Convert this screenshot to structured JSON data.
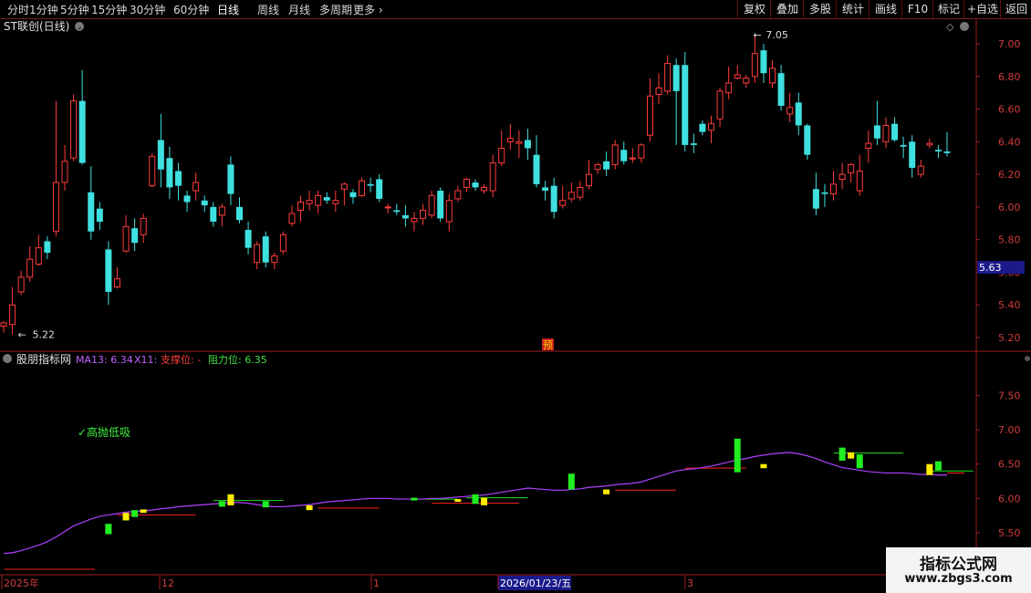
{
  "toolbar": {
    "periods": [
      "分时",
      "1分钟",
      "5分钟",
      "15分钟",
      "30分钟",
      "60分钟",
      "日线",
      "周线",
      "月线",
      "多周期",
      "更多"
    ],
    "active_period": "日线",
    "right_buttons": [
      "复权",
      "叠加",
      "多股",
      "统计",
      "画线",
      "F10",
      "标记",
      "+自选",
      "返回"
    ]
  },
  "stock": {
    "title": "ST联创(日线)"
  },
  "price_panel": {
    "axis_labels": [
      "7.00",
      "6.80",
      "6.60",
      "6.40",
      "6.20",
      "6.00",
      "5.80",
      "5.60",
      "5.40",
      "5.20"
    ],
    "ylim": [
      5.15,
      7.2
    ],
    "high_label": "7.05",
    "low_label": "5.22",
    "current_price_label": "5.63",
    "current_price": 5.63,
    "badge": "预"
  },
  "indicator_panel": {
    "name": "股朋指标网",
    "ma_label": "MA13: 6.34",
    "x11_label": "X11:",
    "support_label": "支撑位: -",
    "resist_label": "阻力位: 6.35",
    "signal_text": "✓高抛低吸",
    "axis_labels": [
      "7.50",
      "7.00",
      "6.50",
      "6.00",
      "5.50"
    ],
    "ylim": [
      5.22,
      8.0
    ]
  },
  "time_axis": {
    "labels": [
      "2025年",
      "12",
      "1",
      "2026/01/23/五",
      "3"
    ]
  },
  "colors": {
    "up": "#ff3c3c",
    "down": "#3fe0e0",
    "ma": "#b040ff",
    "support": "#ff2020",
    "resist": "#20e020",
    "signal_up": "#20ee20",
    "signal_down": "#ffee00",
    "current_bg": "#1a1a8a"
  },
  "chart_data": {
    "type": "candlestick",
    "candles": [
      [
        5.27,
        5.29,
        5.3,
        5.23
      ],
      [
        5.28,
        5.4,
        5.51,
        5.22
      ],
      [
        5.48,
        5.57,
        5.61,
        5.46
      ],
      [
        5.57,
        5.68,
        5.76,
        5.54
      ],
      [
        5.65,
        5.75,
        5.83,
        5.64
      ],
      [
        5.79,
        5.72,
        5.82,
        5.68
      ],
      [
        5.85,
        6.15,
        6.65,
        5.82
      ],
      [
        6.15,
        6.28,
        6.38,
        6.1
      ],
      [
        6.3,
        6.65,
        6.69,
        6.28
      ],
      [
        6.65,
        6.27,
        6.84,
        6.26
      ],
      [
        6.09,
        5.85,
        6.25,
        5.8
      ],
      [
        5.99,
        5.91,
        6.03,
        5.86
      ],
      [
        5.74,
        5.48,
        5.79,
        5.4
      ],
      [
        5.51,
        5.56,
        5.63,
        5.5
      ],
      [
        5.73,
        5.88,
        5.95,
        5.72
      ],
      [
        5.87,
        5.78,
        5.93,
        5.73
      ],
      [
        5.83,
        5.93,
        5.96,
        5.78
      ],
      [
        6.13,
        6.31,
        6.33,
        6.12
      ],
      [
        6.41,
        6.23,
        6.57,
        6.12
      ],
      [
        6.3,
        6.12,
        6.37,
        6.05
      ],
      [
        6.22,
        6.13,
        6.27,
        6.04
      ],
      [
        6.07,
        6.03,
        6.1,
        5.97
      ],
      [
        6.1,
        6.15,
        6.21,
        6.04
      ],
      [
        6.04,
        6.01,
        6.07,
        5.97
      ],
      [
        6.0,
        5.91,
        6.03,
        5.88
      ],
      [
        5.95,
        6.0,
        6.02,
        5.88
      ],
      [
        6.26,
        6.08,
        6.31,
        6.01
      ],
      [
        6.0,
        5.92,
        6.06,
        5.9
      ],
      [
        5.86,
        5.75,
        5.91,
        5.71
      ],
      [
        5.66,
        5.77,
        5.79,
        5.62
      ],
      [
        5.82,
        5.66,
        5.85,
        5.63
      ],
      [
        5.66,
        5.7,
        5.72,
        5.62
      ],
      [
        5.73,
        5.83,
        5.85,
        5.71
      ],
      [
        5.9,
        5.96,
        6.01,
        5.88
      ],
      [
        5.98,
        6.03,
        6.07,
        5.91
      ],
      [
        6.02,
        6.04,
        6.1,
        5.98
      ],
      [
        6.01,
        6.07,
        6.1,
        5.96
      ],
      [
        6.06,
        6.04,
        6.09,
        6.02
      ],
      [
        6.02,
        6.04,
        6.1,
        5.97
      ],
      [
        6.11,
        6.14,
        6.15,
        6.01
      ],
      [
        6.09,
        6.06,
        6.11,
        6.02
      ],
      [
        6.07,
        6.16,
        6.18,
        6.06
      ],
      [
        6.14,
        6.13,
        6.18,
        6.09
      ],
      [
        6.17,
        6.05,
        6.2,
        6.03
      ],
      [
        6.0,
        6.0,
        6.02,
        5.96
      ],
      [
        5.98,
        5.97,
        6.02,
        5.95
      ],
      [
        5.95,
        5.93,
        6.01,
        5.88
      ],
      [
        5.91,
        5.93,
        5.97,
        5.85
      ],
      [
        5.93,
        5.98,
        6.02,
        5.89
      ],
      [
        5.95,
        6.07,
        6.1,
        5.93
      ],
      [
        6.1,
        5.93,
        6.12,
        5.91
      ],
      [
        5.91,
        6.04,
        6.08,
        5.85
      ],
      [
        6.05,
        6.1,
        6.13,
        6.03
      ],
      [
        6.12,
        6.17,
        6.18,
        6.09
      ],
      [
        6.15,
        6.12,
        6.17,
        6.1
      ],
      [
        6.1,
        6.12,
        6.14,
        6.08
      ],
      [
        6.1,
        6.27,
        6.32,
        6.06
      ],
      [
        6.27,
        6.36,
        6.47,
        6.25
      ],
      [
        6.4,
        6.42,
        6.51,
        6.35
      ],
      [
        6.39,
        6.4,
        6.47,
        6.3
      ],
      [
        6.41,
        6.36,
        6.48,
        6.29
      ],
      [
        6.32,
        6.14,
        6.44,
        6.12
      ],
      [
        6.12,
        6.1,
        6.16,
        6.04
      ],
      [
        6.13,
        5.97,
        6.18,
        5.93
      ],
      [
        6.01,
        6.04,
        6.13,
        5.99
      ],
      [
        6.05,
        6.09,
        6.15,
        6.03
      ],
      [
        6.06,
        6.12,
        6.16,
        6.04
      ],
      [
        6.13,
        6.2,
        6.29,
        6.11
      ],
      [
        6.23,
        6.26,
        6.27,
        6.2
      ],
      [
        6.28,
        6.23,
        6.34,
        6.19
      ],
      [
        6.26,
        6.38,
        6.41,
        6.23
      ],
      [
        6.35,
        6.28,
        6.4,
        6.26
      ],
      [
        6.3,
        6.3,
        6.36,
        6.27
      ],
      [
        6.3,
        6.38,
        6.39,
        6.27
      ],
      [
        6.44,
        6.68,
        6.79,
        6.4
      ],
      [
        6.69,
        6.73,
        6.82,
        6.63
      ],
      [
        6.71,
        6.88,
        6.93,
        6.69
      ],
      [
        6.87,
        6.71,
        6.91,
        6.38
      ],
      [
        6.87,
        6.38,
        6.95,
        6.34
      ],
      [
        6.39,
        6.38,
        6.45,
        6.33
      ],
      [
        6.51,
        6.46,
        6.53,
        6.44
      ],
      [
        6.47,
        6.51,
        6.56,
        6.39
      ],
      [
        6.54,
        6.71,
        6.73,
        6.49
      ],
      [
        6.7,
        6.76,
        6.86,
        6.66
      ],
      [
        6.79,
        6.81,
        6.87,
        6.78
      ],
      [
        6.76,
        6.79,
        6.81,
        6.73
      ],
      [
        6.8,
        6.94,
        7.05,
        6.76
      ],
      [
        6.96,
        6.82,
        7.0,
        6.76
      ],
      [
        6.76,
        6.85,
        6.9,
        6.73
      ],
      [
        6.82,
        6.62,
        6.87,
        6.59
      ],
      [
        6.57,
        6.61,
        6.7,
        6.52
      ],
      [
        6.64,
        6.5,
        6.7,
        6.44
      ],
      [
        6.5,
        6.32,
        6.51,
        6.29
      ],
      [
        6.11,
        5.99,
        6.21,
        5.95
      ],
      [
        6.09,
        6.08,
        6.14,
        6.0
      ],
      [
        6.08,
        6.14,
        6.22,
        6.04
      ],
      [
        6.17,
        6.2,
        6.27,
        6.11
      ],
      [
        6.21,
        6.26,
        6.27,
        6.15
      ],
      [
        6.1,
        6.22,
        6.32,
        6.07
      ],
      [
        6.36,
        6.39,
        6.47,
        6.27
      ],
      [
        6.5,
        6.42,
        6.65,
        6.38
      ],
      [
        6.4,
        6.5,
        6.55,
        6.36
      ],
      [
        6.51,
        6.41,
        6.55,
        6.4
      ],
      [
        6.38,
        6.37,
        6.43,
        6.3
      ],
      [
        6.4,
        6.24,
        6.44,
        6.18
      ],
      [
        6.2,
        6.25,
        6.29,
        6.18
      ],
      [
        6.38,
        6.39,
        6.42,
        6.36
      ],
      [
        6.35,
        6.34,
        6.38,
        6.3
      ],
      [
        6.34,
        6.33,
        6.46,
        6.31
      ]
    ],
    "ma13": [
      5.2,
      5.21,
      5.24,
      5.28,
      5.32,
      5.37,
      5.44,
      5.52,
      5.6,
      5.65,
      5.7,
      5.74,
      5.76,
      5.78,
      5.8,
      5.81,
      5.82,
      5.83,
      5.85,
      5.86,
      5.88,
      5.89,
      5.9,
      5.91,
      5.92,
      5.93,
      5.94,
      5.94,
      5.93,
      5.91,
      5.89,
      5.88,
      5.88,
      5.89,
      5.9,
      5.91,
      5.93,
      5.95,
      5.96,
      5.97,
      5.98,
      5.99,
      6.0,
      6.0,
      6.0,
      5.99,
      5.99,
      5.99,
      5.99,
      6.0,
      6.0,
      6.01,
      6.02,
      6.03,
      6.04,
      6.05,
      6.07,
      6.09,
      6.11,
      6.13,
      6.15,
      6.14,
      6.13,
      6.12,
      6.12,
      6.13,
      6.14,
      6.16,
      6.17,
      6.18,
      6.2,
      6.21,
      6.22,
      6.24,
      6.28,
      6.32,
      6.36,
      6.4,
      6.42,
      6.43,
      6.45,
      6.47,
      6.5,
      6.53,
      6.56,
      6.58,
      6.61,
      6.63,
      6.65,
      6.66,
      6.67,
      6.65,
      6.62,
      6.58,
      6.53,
      6.49,
      6.45,
      6.43,
      6.41,
      6.39,
      6.38,
      6.37,
      6.37,
      6.37,
      6.36,
      6.35,
      6.35,
      6.34,
      6.34
    ],
    "signals": [
      {
        "i": 12,
        "y1": 5.63,
        "y2": 5.48,
        "color": "green"
      },
      {
        "i": 14,
        "y1": 5.79,
        "y2": 5.68,
        "color": "yellow"
      },
      {
        "i": 15,
        "y1": 5.83,
        "y2": 5.73,
        "color": "green"
      },
      {
        "i": 16,
        "y1": 5.84,
        "y2": 5.79,
        "color": "yellow"
      },
      {
        "i": 25,
        "y1": 5.96,
        "y2": 5.88,
        "color": "green"
      },
      {
        "i": 26,
        "y1": 6.06,
        "y2": 5.9,
        "color": "yellow"
      },
      {
        "i": 30,
        "y1": 5.96,
        "y2": 5.87,
        "color": "green"
      },
      {
        "i": 35,
        "y1": 5.9,
        "y2": 5.83,
        "color": "yellow"
      },
      {
        "i": 47,
        "y1": 6.01,
        "y2": 5.97,
        "color": "green"
      },
      {
        "i": 52,
        "y1": 5.99,
        "y2": 5.95,
        "color": "yellow"
      },
      {
        "i": 54,
        "y1": 6.06,
        "y2": 5.92,
        "color": "green"
      },
      {
        "i": 55,
        "y1": 6.01,
        "y2": 5.9,
        "color": "yellow"
      },
      {
        "i": 65,
        "y1": 6.36,
        "y2": 6.13,
        "color": "green"
      },
      {
        "i": 69,
        "y1": 6.13,
        "y2": 6.06,
        "color": "yellow"
      },
      {
        "i": 84,
        "y1": 6.87,
        "y2": 6.38,
        "color": "green"
      },
      {
        "i": 87,
        "y1": 6.5,
        "y2": 6.44,
        "color": "yellow"
      },
      {
        "i": 96,
        "y1": 6.74,
        "y2": 6.55,
        "color": "green"
      },
      {
        "i": 97,
        "y1": 6.67,
        "y2": 6.58,
        "color": "yellow"
      },
      {
        "i": 98,
        "y1": 6.64,
        "y2": 6.44,
        "color": "green"
      },
      {
        "i": 106,
        "y1": 6.5,
        "y2": 6.34,
        "color": "yellow"
      },
      {
        "i": 107,
        "y1": 6.54,
        "y2": 6.41,
        "color": "green"
      }
    ],
    "support_lines": [
      [
        13,
        22,
        5.76
      ],
      [
        36,
        43,
        5.86
      ],
      [
        49,
        59,
        5.93
      ],
      [
        70,
        77,
        6.12
      ],
      [
        78,
        85,
        6.44
      ],
      [
        108,
        110,
        6.37
      ]
    ],
    "resist_lines": [
      [
        24,
        32,
        5.97
      ],
      [
        47,
        52,
        5.99
      ],
      [
        53,
        60,
        6.01
      ],
      [
        95,
        103,
        6.66
      ],
      [
        106,
        111,
        6.4
      ]
    ]
  }
}
